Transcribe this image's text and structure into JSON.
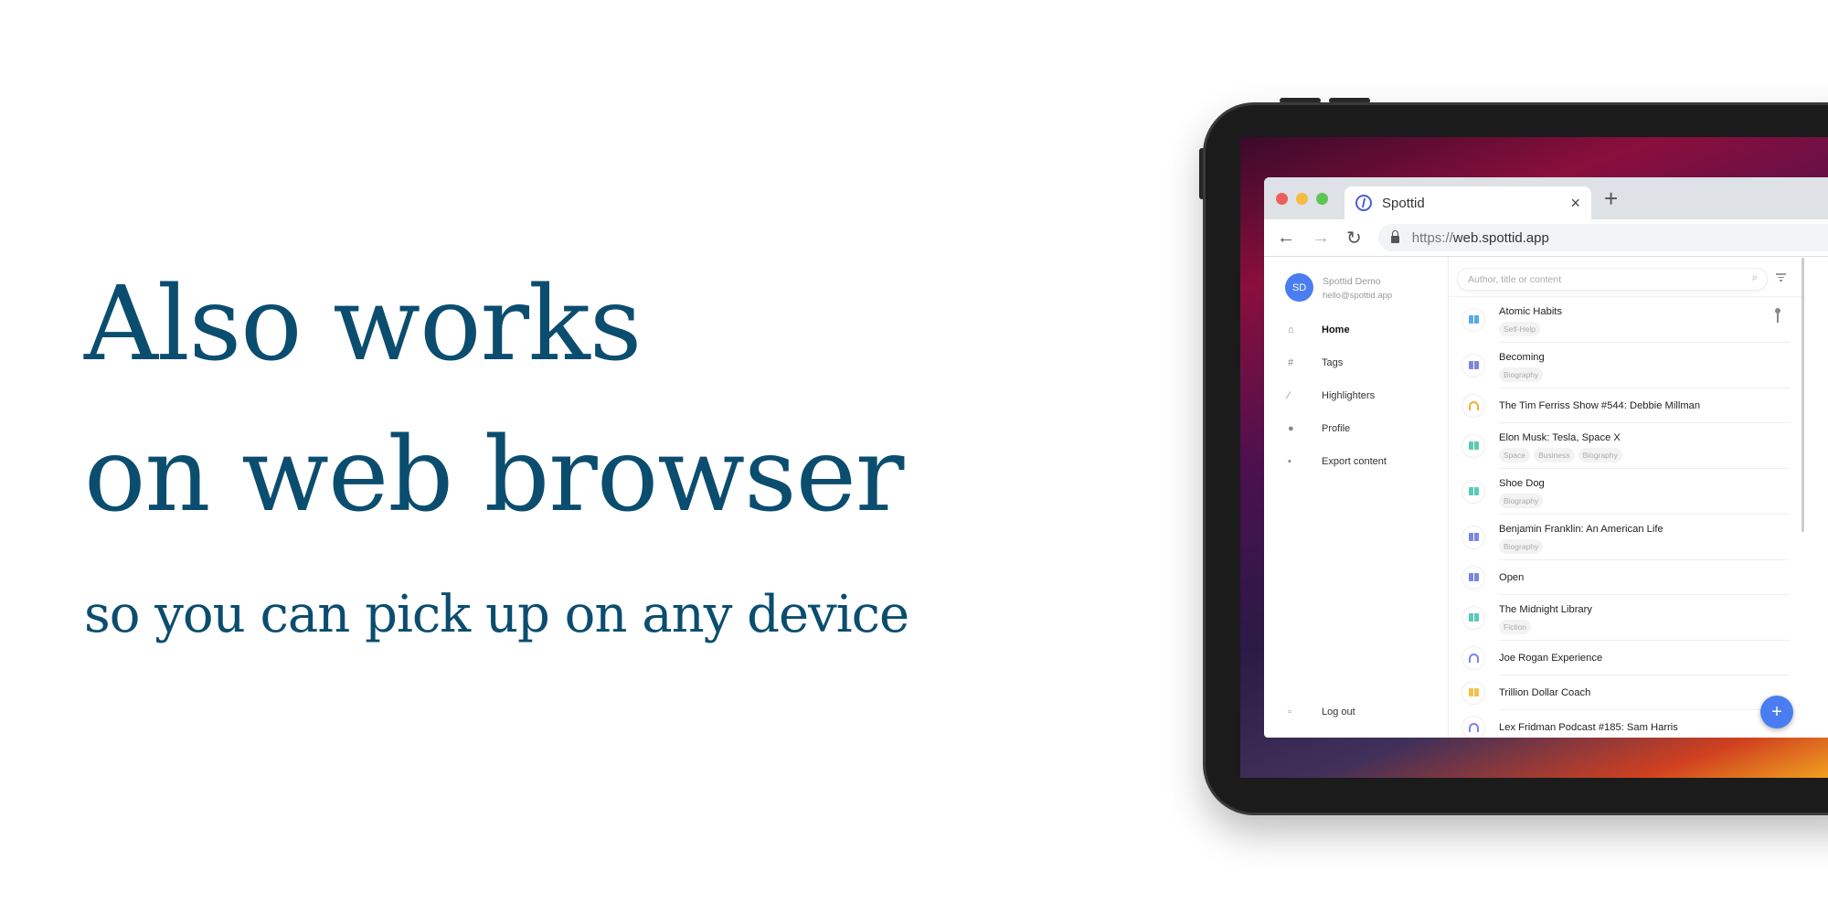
{
  "hero": {
    "line1": "Also works",
    "line2": "on web browser",
    "subtitle": "so you can pick up on any device"
  },
  "browser": {
    "tab_title": "Spottid",
    "tab_close": "×",
    "new_tab": "+",
    "back": "←",
    "forward": "→",
    "reload": "↻",
    "url_scheme": "https://",
    "url_host": "web.spottid.app"
  },
  "user": {
    "initials": "SD",
    "name": "Spottid Demo",
    "email": "hello@spottid.app"
  },
  "nav": [
    {
      "label": "Home",
      "icon": "home-icon",
      "glyph": "⌂"
    },
    {
      "label": "Tags",
      "icon": "hash-icon",
      "glyph": "#"
    },
    {
      "label": "Highlighters",
      "icon": "pen-icon",
      "glyph": "⁄"
    },
    {
      "label": "Profile",
      "icon": "person-icon",
      "glyph": "●"
    },
    {
      "label": "Export content",
      "icon": "export-icon",
      "glyph": "▪"
    }
  ],
  "logout": "Log out",
  "search": {
    "placeholder": "Author, title or content",
    "icon": "search-icon"
  },
  "items": [
    {
      "title": "Atomic Habits",
      "type": "book",
      "color": "#5aa9e6",
      "tags": [
        "Self-Help"
      ],
      "pinned": true
    },
    {
      "title": "Becoming",
      "type": "book",
      "color": "#7b86e0",
      "tags": [
        "Biography"
      ]
    },
    {
      "title": "The Tim Ferriss Show #544: Debbie Millman",
      "type": "podcast",
      "color": "#f2b134",
      "tags": []
    },
    {
      "title": "Elon Musk: Tesla, Space X",
      "type": "book",
      "color": "#5cc9b5",
      "tags": [
        "Space",
        "Business",
        "Biography"
      ]
    },
    {
      "title": "Shoe Dog",
      "type": "book",
      "color": "#5cc9b5",
      "tags": [
        "Biography"
      ]
    },
    {
      "title": "Benjamin Franklin: An American Life",
      "type": "book",
      "color": "#7b86e0",
      "tags": [
        "Biography"
      ]
    },
    {
      "title": "Open",
      "type": "book",
      "color": "#7b86e0",
      "tags": []
    },
    {
      "title": "The Midnight Library",
      "type": "book",
      "color": "#5cc9b5",
      "tags": [
        "Fiction"
      ]
    },
    {
      "title": "Joe Rogan Experience",
      "type": "podcast",
      "color": "#7b86e0",
      "tags": []
    },
    {
      "title": "Trillion Dollar Coach",
      "type": "book",
      "color": "#f2c14e",
      "tags": []
    },
    {
      "title": "Lex Fridman Podcast #185: Sam Harris",
      "type": "podcast",
      "color": "#7b86e0",
      "tags": []
    }
  ],
  "fab": "+",
  "colors": {
    "heading": "#0b4d6f",
    "accent": "#4a7ef0"
  }
}
